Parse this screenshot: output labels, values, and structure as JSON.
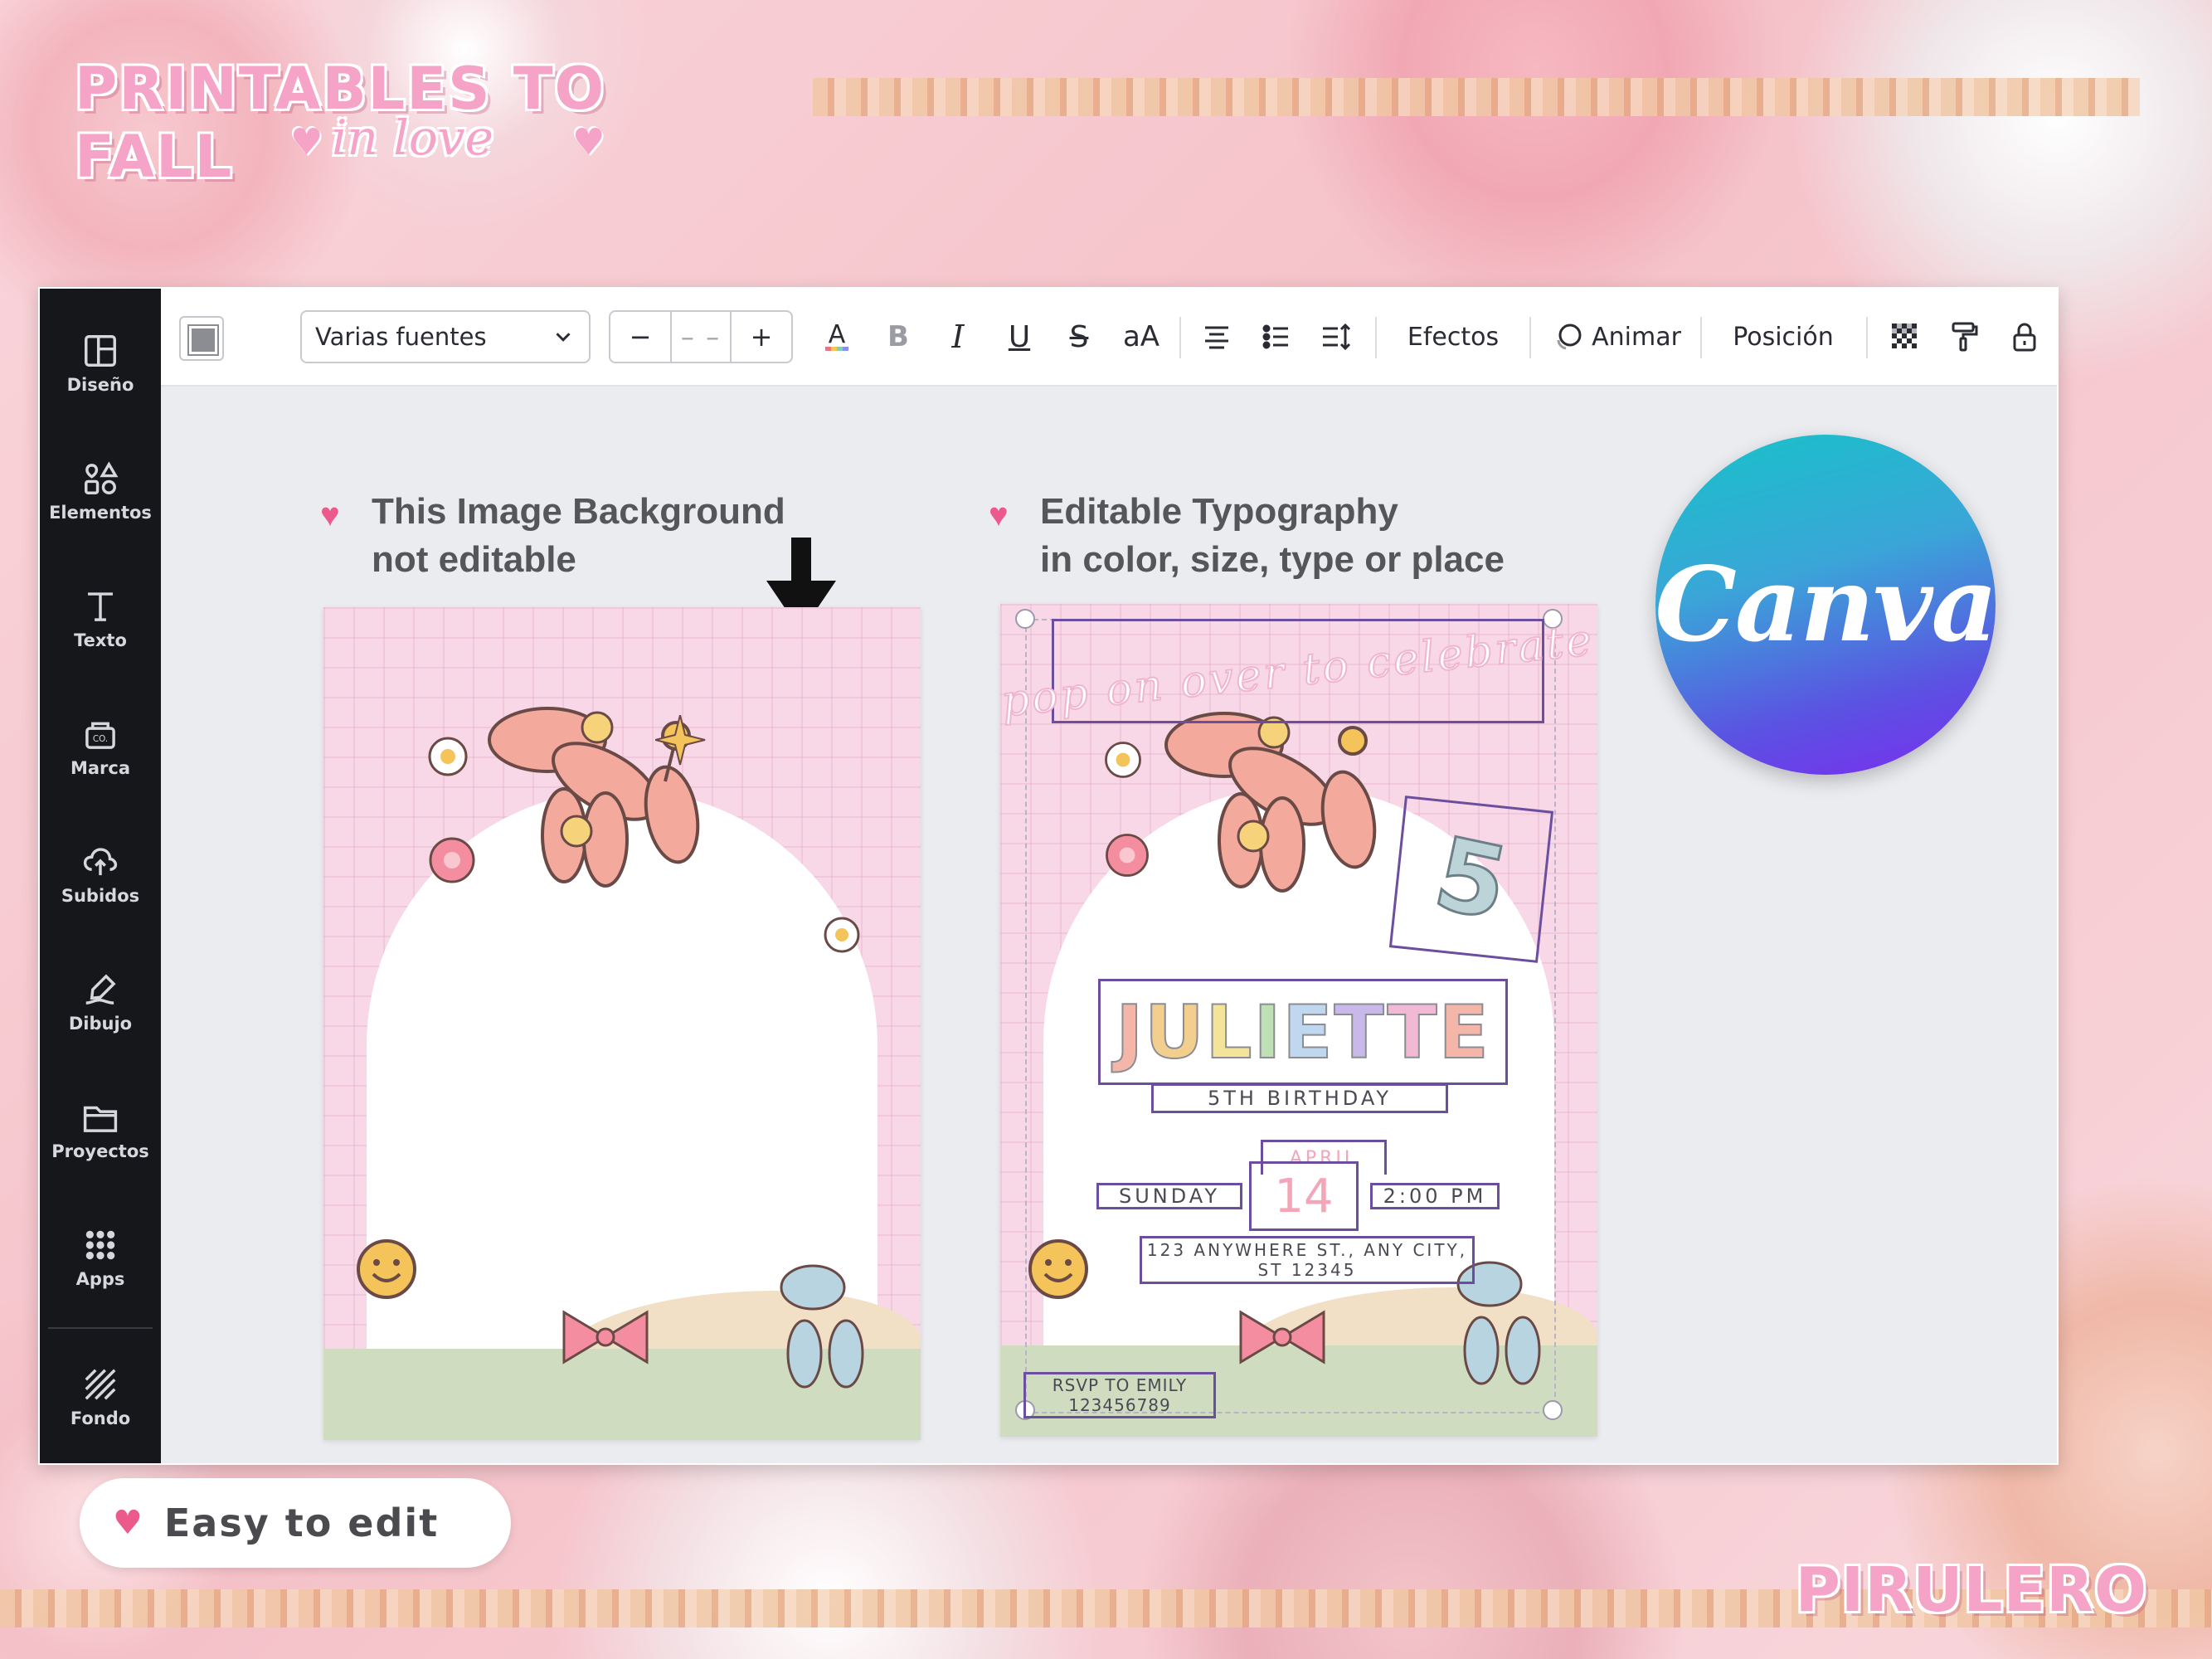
{
  "branding": {
    "top_logo_line1": "PRINTABLES TO FALL",
    "top_logo_line2": "in love",
    "bottom_logo": "PIRULERO",
    "canva_logo": "Canva"
  },
  "sidebar": {
    "items": [
      {
        "label": "Diseño",
        "icon": "layout-icon"
      },
      {
        "label": "Elementos",
        "icon": "shapes-icon"
      },
      {
        "label": "Texto",
        "icon": "text-icon"
      },
      {
        "label": "Marca",
        "icon": "brand-icon"
      },
      {
        "label": "Subidos",
        "icon": "upload-cloud-icon"
      },
      {
        "label": "Dibujo",
        "icon": "draw-pen-icon"
      },
      {
        "label": "Proyectos",
        "icon": "folder-icon"
      },
      {
        "label": "Apps",
        "icon": "apps-grid-icon"
      },
      {
        "label": "Fondo",
        "icon": "background-hatch-icon"
      }
    ]
  },
  "toolbar": {
    "font_family": "Varias fuentes",
    "size_minus": "−",
    "size_value": "– –",
    "size_plus": "+",
    "effects": "Efectos",
    "animate": "Animar",
    "position": "Posición"
  },
  "captions": {
    "left_line1": "This Image Background",
    "left_line2": "not editable",
    "right_line1": "Editable Typography",
    "right_line2": "in color, size, type or place"
  },
  "invitation": {
    "pop": "pop on over to celebrate",
    "number": "5",
    "name": "JULIETTE",
    "birthday": "5TH BIRTHDAY",
    "month": "APRIL",
    "day": "14",
    "weekday": "SUNDAY",
    "time": "2:00 PM",
    "address_line1": "123 ANYWHERE ST., ANY CITY,",
    "address_line2": "ST 12345",
    "rsvp_line1": "RSVP TO EMILY",
    "rsvp_line2": "123456789"
  },
  "name_letter_colors": [
    "#f4b6a8",
    "#f2cf8f",
    "#f4e49a",
    "#bfe0b4",
    "#bfd7ef",
    "#c9b9ea",
    "#f2b9d4",
    "#f4b6a8"
  ],
  "easy_badge": "Easy to edit"
}
